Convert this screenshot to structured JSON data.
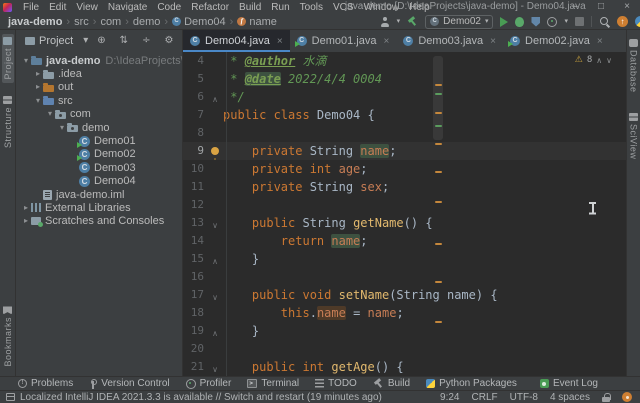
{
  "window": {
    "title": "java-demo [D:\\IdeaProjects\\java-demo] - Demo04.java",
    "controls": [
      "minimize",
      "maximize",
      "close"
    ]
  },
  "menubar": {
    "items": [
      "File",
      "Edit",
      "View",
      "Navigate",
      "Code",
      "Refactor",
      "Build",
      "Run",
      "Tools",
      "VCS",
      "Window",
      "Help"
    ]
  },
  "breadcrumbs": {
    "items": [
      {
        "label": "java-demo",
        "bold": true
      },
      {
        "label": "src"
      },
      {
        "label": "com"
      },
      {
        "label": "demo"
      },
      {
        "label": "Demo04",
        "icon": "class"
      },
      {
        "label": "name",
        "icon": "field"
      }
    ]
  },
  "run_toolbar": {
    "config_name": "Demo02",
    "icons": [
      "user",
      "build-hammer",
      "run",
      "debug",
      "coverage",
      "profiler",
      "stop",
      "search",
      "updates",
      "plugin"
    ]
  },
  "left_strip": {
    "top": [
      "Project",
      "Structure"
    ],
    "bottom": [
      "Bookmarks"
    ]
  },
  "right_strip": {
    "top": [
      "Database",
      "SciView"
    ]
  },
  "project_panel": {
    "title": "Project",
    "header_icons": [
      {
        "name": "locate",
        "g": "⊕"
      },
      {
        "name": "expand-collapse",
        "g": "⇅"
      },
      {
        "name": "collapse-all",
        "g": "÷"
      },
      {
        "name": "settings-gear",
        "g": "⚙"
      },
      {
        "name": "hide-panel",
        "g": "−"
      }
    ],
    "tree": [
      {
        "label": "java-demo",
        "hint": "D:\\IdeaProjects\\java-demo",
        "level": 0,
        "chev": "▾",
        "icon": "folder proj",
        "bold": true
      },
      {
        "label": ".idea",
        "level": 1,
        "chev": "▸",
        "icon": "folder"
      },
      {
        "label": "out",
        "level": 1,
        "chev": "▸",
        "icon": "folder out"
      },
      {
        "label": "src",
        "level": 1,
        "chev": "▾",
        "icon": "folder src"
      },
      {
        "label": "com",
        "level": 2,
        "chev": "▾",
        "icon": "folder pkg"
      },
      {
        "label": "demo",
        "level": 3,
        "chev": "▾",
        "icon": "folder pkg"
      },
      {
        "label": "Demo01",
        "level": 4,
        "icon": "class run"
      },
      {
        "label": "Demo02",
        "level": 4,
        "icon": "class run"
      },
      {
        "label": "Demo03",
        "level": 4,
        "icon": "class"
      },
      {
        "label": "Demo04",
        "level": 4,
        "icon": "class"
      },
      {
        "label": "java-demo.iml",
        "level": 1,
        "icon": "iml"
      },
      {
        "label": "External Libraries",
        "level": 0,
        "chev": "▸",
        "icon": "lib"
      },
      {
        "label": "Scratches and Consoles",
        "level": 0,
        "chev": "▸",
        "icon": "scratch"
      }
    ]
  },
  "editor": {
    "tabs": [
      {
        "label": "Demo04.java",
        "icon": "class",
        "active": true
      },
      {
        "label": "Demo01.java",
        "icon": "class run"
      },
      {
        "label": "Demo03.java",
        "icon": "class"
      },
      {
        "label": "Demo02.java",
        "icon": "class run"
      }
    ],
    "warnings": {
      "count": "8"
    },
    "lines": [
      {
        "n": 4,
        "tokens": [
          {
            "c": "c",
            "t": " * "
          },
          {
            "c": "t",
            "t": "@author"
          },
          {
            "c": "c",
            "t": " 水滴"
          }
        ]
      },
      {
        "n": 5,
        "tokens": [
          {
            "c": "c",
            "t": " * "
          },
          {
            "c": "t r",
            "t": "@date"
          },
          {
            "c": "c",
            "t": " 2022/4/4 0004"
          }
        ]
      },
      {
        "n": 6,
        "fold": "u",
        "tokens": [
          {
            "c": "c",
            "t": " */"
          }
        ]
      },
      {
        "n": 7,
        "tokens": [
          {
            "c": "k",
            "t": "public class "
          },
          {
            "c": "p",
            "t": "Demo04 {"
          }
        ]
      },
      {
        "n": 8,
        "tokens": []
      },
      {
        "n": 9,
        "cur": true,
        "bulb": true,
        "tokens": [
          {
            "c": "p",
            "t": "    "
          },
          {
            "c": "k",
            "t": "private "
          },
          {
            "c": "p",
            "t": "String "
          },
          {
            "c": "f r",
            "t": "name"
          },
          {
            "c": "p",
            "t": ";"
          }
        ]
      },
      {
        "n": 10,
        "tokens": [
          {
            "c": "p",
            "t": "    "
          },
          {
            "c": "k",
            "t": "private int "
          },
          {
            "c": "f",
            "t": "age"
          },
          {
            "c": "p",
            "t": ";"
          }
        ]
      },
      {
        "n": 11,
        "tokens": [
          {
            "c": "p",
            "t": "    "
          },
          {
            "c": "k",
            "t": "private "
          },
          {
            "c": "p",
            "t": "String "
          },
          {
            "c": "f",
            "t": "sex"
          },
          {
            "c": "p",
            "t": ";"
          }
        ]
      },
      {
        "n": 12,
        "tokens": []
      },
      {
        "n": 13,
        "fold": "d",
        "tokens": [
          {
            "c": "p",
            "t": "    "
          },
          {
            "c": "k",
            "t": "public "
          },
          {
            "c": "p",
            "t": "String "
          },
          {
            "c": "m",
            "t": "getName"
          },
          {
            "c": "p",
            "t": "() {"
          }
        ]
      },
      {
        "n": 14,
        "tokens": [
          {
            "c": "p",
            "t": "        "
          },
          {
            "c": "k",
            "t": "return "
          },
          {
            "c": "f r",
            "t": "name"
          },
          {
            "c": "p",
            "t": ";"
          }
        ]
      },
      {
        "n": 15,
        "fold": "u",
        "tokens": [
          {
            "c": "p",
            "t": "    }"
          }
        ]
      },
      {
        "n": 16,
        "tokens": []
      },
      {
        "n": 17,
        "fold": "d",
        "tokens": [
          {
            "c": "p",
            "t": "    "
          },
          {
            "c": "k",
            "t": "public void "
          },
          {
            "c": "m",
            "t": "setName"
          },
          {
            "c": "p",
            "t": "(String name) {"
          }
        ]
      },
      {
        "n": 18,
        "tokens": [
          {
            "c": "p",
            "t": "        "
          },
          {
            "c": "k",
            "t": "this"
          },
          {
            "c": "p",
            "t": "."
          },
          {
            "c": "f w",
            "t": "name"
          },
          {
            "c": "p",
            "t": " = "
          },
          {
            "c": "f",
            "t": "name"
          },
          {
            "c": "p",
            "t": ";"
          }
        ]
      },
      {
        "n": 19,
        "fold": "u",
        "tokens": [
          {
            "c": "p",
            "t": "    }"
          }
        ]
      },
      {
        "n": 20,
        "tokens": []
      },
      {
        "n": 21,
        "fold": "d",
        "tokens": [
          {
            "c": "p",
            "t": "    "
          },
          {
            "c": "k",
            "t": "public int "
          },
          {
            "c": "m",
            "t": "getAge"
          },
          {
            "c": "p",
            "t": "() {"
          }
        ]
      }
    ]
  },
  "tool_bar": {
    "items": [
      {
        "label": "Problems",
        "icon": "problem"
      },
      {
        "label": "Version Control",
        "icon": "branch"
      },
      {
        "label": "Profiler",
        "icon": "gauge"
      },
      {
        "label": "Terminal",
        "icon": "terminal"
      },
      {
        "label": "TODO",
        "icon": "todo"
      },
      {
        "label": "Build",
        "icon": "hammer-sm"
      },
      {
        "label": "Python Packages",
        "icon": "python"
      }
    ],
    "right": {
      "label": "Event Log",
      "icon": "event"
    }
  },
  "status_bar": {
    "message": "Localized IntelliJ IDEA 2021.3.3 is available // Switch and restart (19 minutes ago)",
    "items": [
      "9:24",
      "CRLF",
      "UTF-8",
      "4 spaces"
    ]
  },
  "colors": {
    "panel_bg": "#3c3f41",
    "editor_bg": "#2b2b2b",
    "accent_tab": "#4a88c7",
    "keyword": "#cc7832",
    "comment": "#629755",
    "field": "#c77d55",
    "run_green": "#499c54",
    "warning_stripe": "#c4873c"
  }
}
